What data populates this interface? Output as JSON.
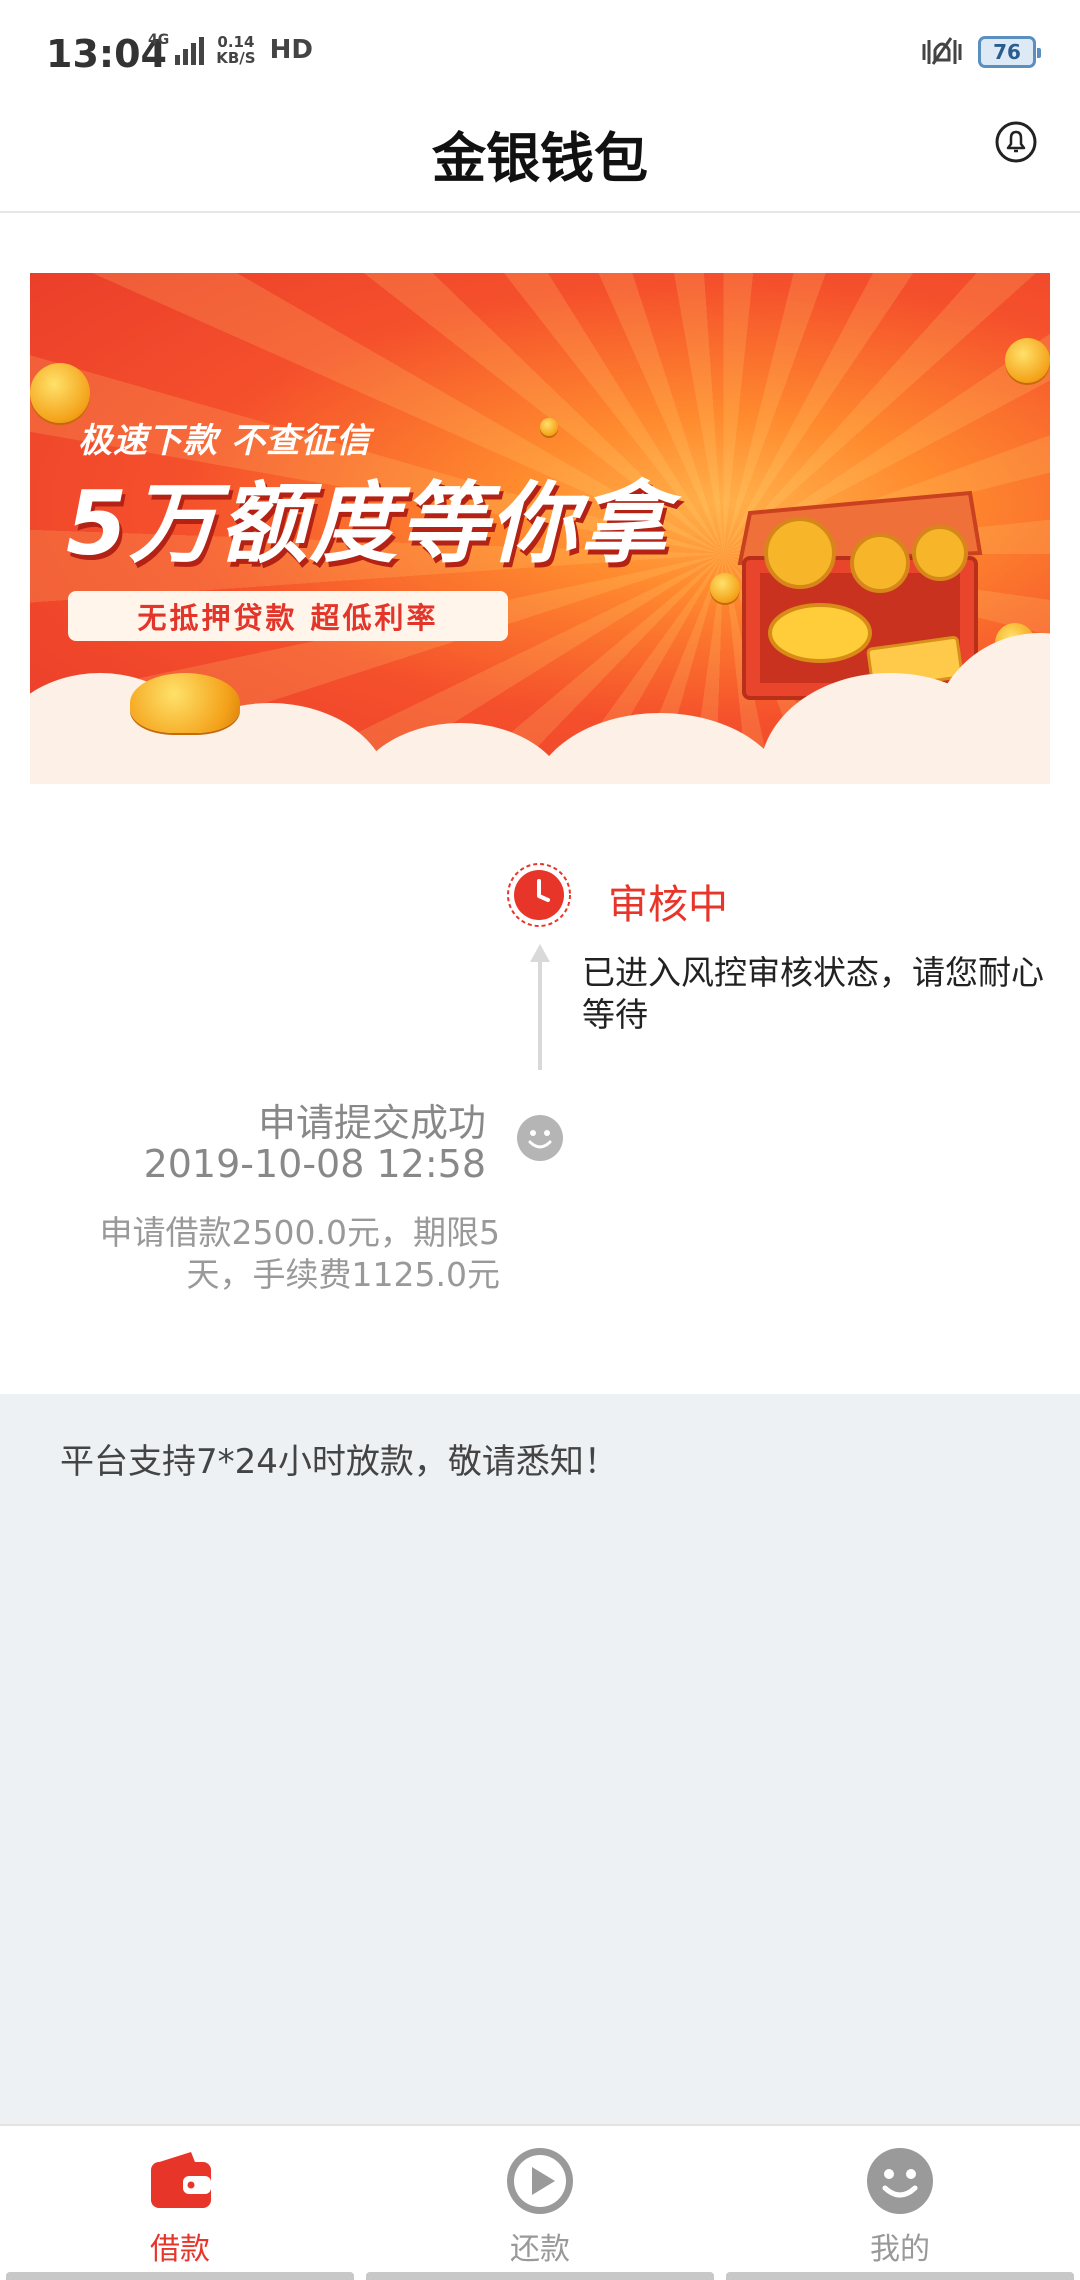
{
  "status_bar": {
    "time": "13:04",
    "network": "4G",
    "speed_value": "0.14",
    "speed_unit": "KB/S",
    "hd": "HD",
    "battery": "76",
    "icons": [
      "signal-icon",
      "vibrate-icon",
      "battery-icon"
    ]
  },
  "header": {
    "title": "金银钱包",
    "right_icon": "bell-icon"
  },
  "banner": {
    "subtitle": "极速下款 不查征信",
    "headline": "5万额度等你拿",
    "pill": "无抵押贷款 超低利率",
    "colors": {
      "background": "#f0412c",
      "accent": "#ffb04a"
    }
  },
  "timeline": {
    "current": {
      "status": "审核中",
      "description": "已进入风控审核状态，请您耐心等待",
      "icon": "clock-icon",
      "color": "#e8352a"
    },
    "past": {
      "title": "申请提交成功",
      "datetime": "2019-10-08 12:58",
      "detail": "申请借款2500.0元，期限5天，手续费1125.0元",
      "icon": "smile-icon"
    }
  },
  "notice": {
    "text": "平台支持7*24小时放款，敬请悉知！"
  },
  "bottom_nav": {
    "items": [
      {
        "label": "借款",
        "icon": "wallet-icon",
        "active": true
      },
      {
        "label": "还款",
        "icon": "play-icon",
        "active": false
      },
      {
        "label": "我的",
        "icon": "smiley-icon",
        "active": false
      }
    ],
    "colors": {
      "active": "#e8352a",
      "inactive": "#999999"
    }
  }
}
